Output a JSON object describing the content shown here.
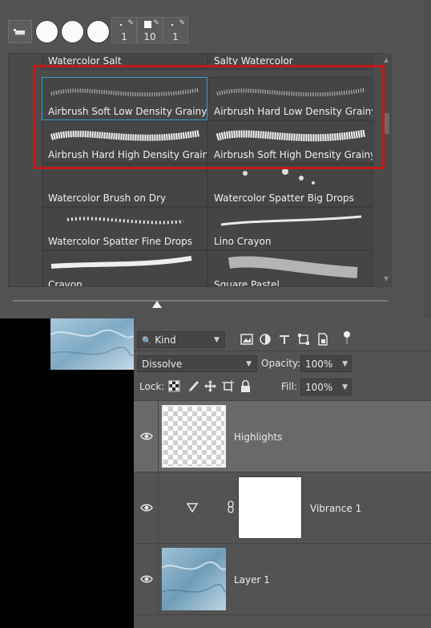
{
  "brush_panel": {
    "presets": [
      {
        "size": "1"
      },
      {
        "size": "10"
      },
      {
        "size": "1"
      }
    ],
    "brushes": [
      {
        "label": "Watercolor Salt"
      },
      {
        "label": "Salty Watercolor"
      },
      {
        "label": "Airbrush Soft Low Density Grainy"
      },
      {
        "label": "Airbrush Hard Low Density Grainy"
      },
      {
        "label": "Airbrush Hard High Density Grainy"
      },
      {
        "label": "Airbrush Soft High Density Grainy"
      },
      {
        "label": "Watercolor Brush on Dry"
      },
      {
        "label": "Watercolor Spatter Big Drops"
      },
      {
        "label": "Watercolor Spatter Fine Drops"
      },
      {
        "label": "Lino Crayon"
      },
      {
        "label": "Crayon"
      },
      {
        "label": "Square Pastel"
      }
    ],
    "selected_index": 2,
    "highlight_color": "#c21a1a"
  },
  "layers_panel": {
    "filter": {
      "value": "Kind"
    },
    "blend_mode": {
      "value": "Dissolve"
    },
    "opacity": {
      "label": "Opacity:",
      "value": "100%"
    },
    "lock": {
      "label": "Lock:"
    },
    "fill": {
      "label": "Fill:",
      "value": "100%"
    },
    "layers": [
      {
        "name": "Highlights",
        "visible": true,
        "selected": true
      },
      {
        "name": "Vibrance 1",
        "visible": true,
        "selected": false
      },
      {
        "name": "Layer 1",
        "visible": true,
        "selected": false
      }
    ]
  }
}
